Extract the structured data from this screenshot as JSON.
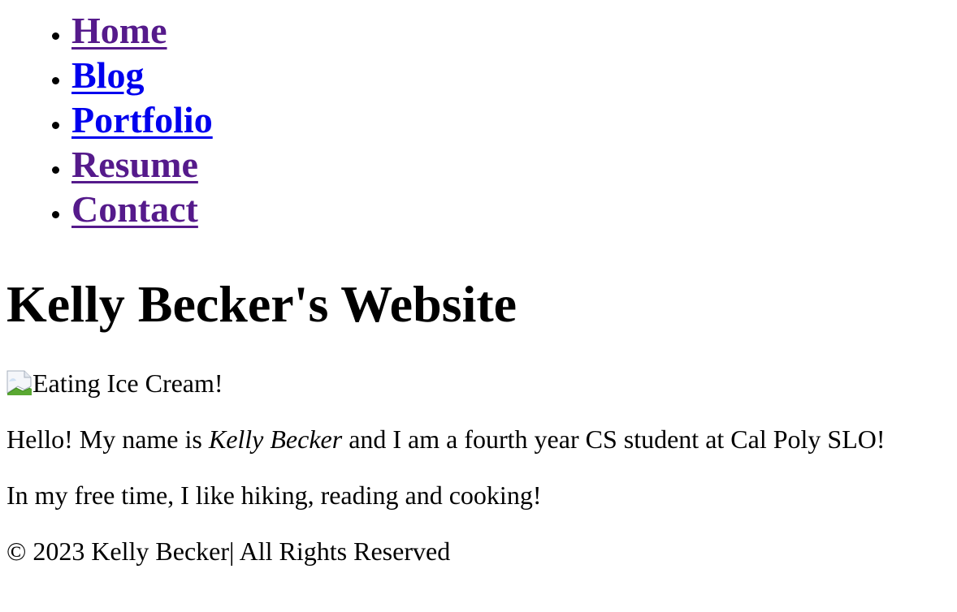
{
  "nav": {
    "items": [
      {
        "label": "Home",
        "state": "visited"
      },
      {
        "label": "Blog",
        "state": "unvisited"
      },
      {
        "label": "Portfolio",
        "state": "unvisited"
      },
      {
        "label": "Resume",
        "state": "visited"
      },
      {
        "label": "Contact",
        "state": "visited"
      }
    ]
  },
  "header": {
    "title": "Kelly Becker's Website"
  },
  "main": {
    "photo": {
      "alt_text": "Eating Ice Cream!",
      "icon": "broken-image-icon"
    },
    "intro": {
      "prefix": "Hello! My name is ",
      "name": "Kelly Becker",
      "suffix": " and I am a fourth year CS student at Cal Poly SLO!"
    },
    "hobbies": "In my free time, I like hiking, reading and cooking!"
  },
  "footer": {
    "copyright": "© 2023 Kelly Becker| All Rights Reserved"
  },
  "colors": {
    "link": "#0000ee",
    "visited_link": "#551a8b",
    "text": "#000000",
    "background": "#ffffff"
  }
}
